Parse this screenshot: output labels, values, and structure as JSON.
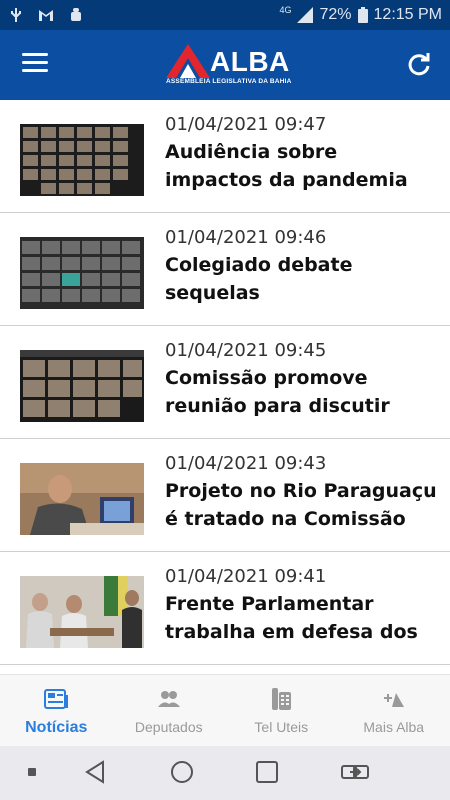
{
  "status_bar": {
    "network_label": "4G",
    "battery": "72%",
    "time": "12:15 PM"
  },
  "header": {
    "logo_word": "ALBA",
    "logo_subtitle": "ASSEMBLEIA LEGISLATIVA DA BAHIA"
  },
  "news": [
    {
      "date": "01/04/2021 09:47",
      "title": "Audiência sobre impactos da pandemia marca o"
    },
    {
      "date": "01/04/2021 09:46",
      "title": "Colegiado debate sequelas cardiovasculares"
    },
    {
      "date": "01/04/2021 09:45",
      "title": "Comissão promove reunião para discutir demandas do"
    },
    {
      "date": "01/04/2021 09:43",
      "title": "Projeto no Rio Paraguaçu é tratado na Comissão de Meio"
    },
    {
      "date": "01/04/2021 09:41",
      "title": "Frente Parlamentar trabalha em defesa dos bares,"
    }
  ],
  "bottom_nav": [
    {
      "label": "Notícias",
      "icon": "newspaper-icon",
      "active": true
    },
    {
      "label": "Deputados",
      "icon": "people-icon",
      "active": false
    },
    {
      "label": "Tel Uteis",
      "icon": "phone-icon",
      "active": false
    },
    {
      "label": "Mais Alba",
      "icon": "plus-shapes-icon",
      "active": false
    }
  ],
  "colors": {
    "status_bar": "#053a78",
    "app_bar": "#0b4ea2",
    "accent": "#2a7ee0",
    "logo_red": "#e3262e"
  }
}
